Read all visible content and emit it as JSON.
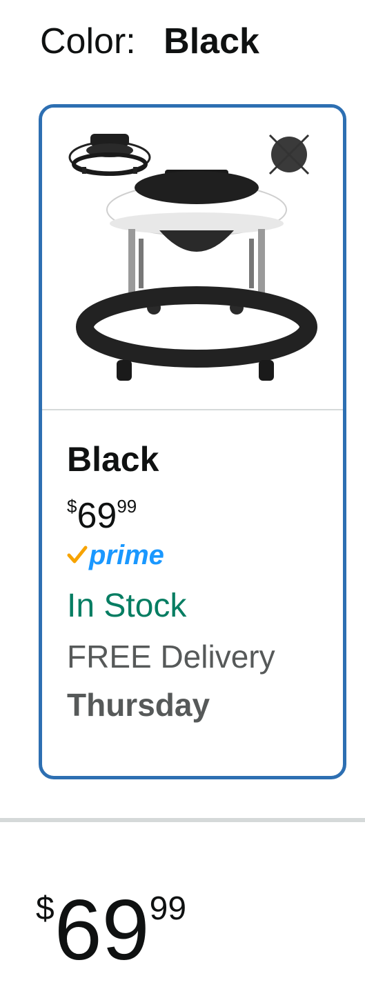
{
  "color_selector": {
    "label": "Color:",
    "value": "Black"
  },
  "swatch": {
    "name": "Black",
    "price": {
      "symbol": "$",
      "whole": "69",
      "fraction": "99"
    },
    "prime_label": "prime",
    "availability": "In Stock",
    "delivery_label": "FREE Delivery",
    "delivery_day": "Thursday",
    "colors": {
      "border": "#2d6fb2",
      "prime": "#1a98ff",
      "check": "#f7a300",
      "stock": "#067d62"
    }
  },
  "main_price": {
    "symbol": "$",
    "whole": "69",
    "fraction": "99"
  }
}
